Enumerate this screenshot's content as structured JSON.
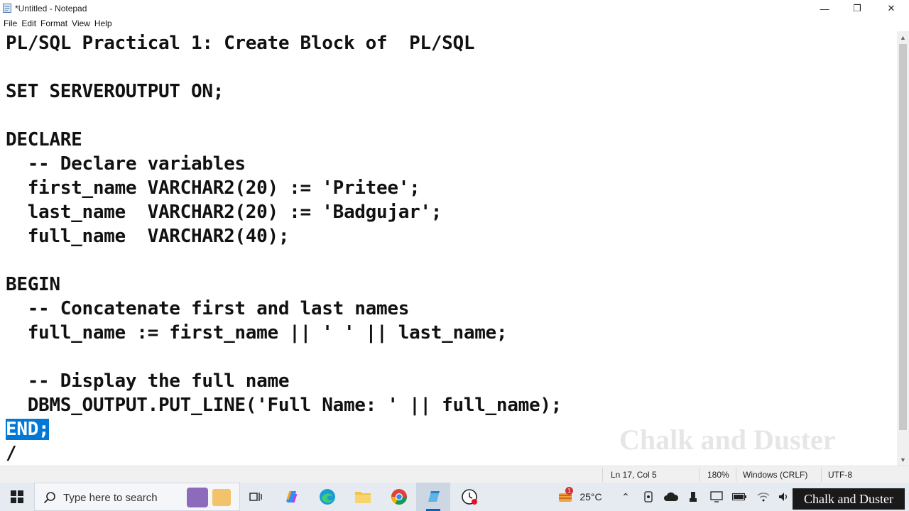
{
  "window": {
    "title": "*Untitled - Notepad"
  },
  "menu": [
    "File",
    "Edit",
    "Format",
    "View",
    "Help"
  ],
  "editor": {
    "lines": [
      "PL/SQL Practical 1: Create Block of  PL/SQL",
      "",
      "SET SERVEROUTPUT ON;",
      "",
      "DECLARE",
      "  -- Declare variables",
      "  first_name VARCHAR2(20) := 'Pritee';",
      "  last_name  VARCHAR2(20) := 'Badgujar';",
      "  full_name  VARCHAR2(40);",
      "",
      "BEGIN",
      "  -- Concatenate first and last names",
      "  full_name := first_name || ' ' || last_name;",
      "",
      "  -- Display the full name",
      "  DBMS_OUTPUT.PUT_LINE('Full Name: ' || full_name);",
      "END;",
      "/"
    ],
    "selected_text": "END;",
    "watermark": "Chalk and Duster"
  },
  "status": {
    "position": "Ln 17, Col 5",
    "zoom": "180%",
    "line_ending": "Windows (CRLF)",
    "encoding": "UTF-8"
  },
  "taskbar": {
    "search_placeholder": "Type here to search",
    "weather_temp": "25°C",
    "weather_badge": "1",
    "channel_label": "Chalk and Duster"
  },
  "colors": {
    "selection": "#0078d7",
    "taskbar_bg": "#e6ebf1",
    "statusbar_bg": "#f0f0f0"
  },
  "icons": [
    "notepad-icon",
    "minimize-icon",
    "maximize-icon",
    "close-icon",
    "windows-start-icon",
    "search-icon",
    "task-view-icon",
    "copilot-icon",
    "edge-icon",
    "file-explorer-icon",
    "chrome-icon",
    "notepad-taskbar-icon",
    "clock-app-icon",
    "weather-icon",
    "chevron-up-icon",
    "meet-icon",
    "onedrive-icon",
    "usb-icon",
    "display-icon",
    "battery-icon",
    "wifi-icon",
    "volume-icon"
  ]
}
